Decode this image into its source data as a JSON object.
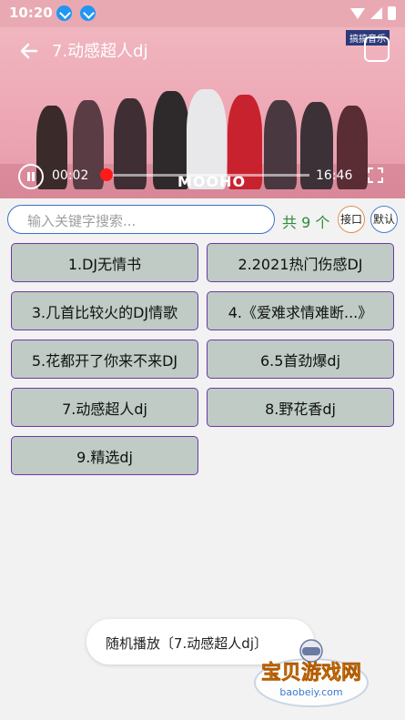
{
  "status_bar": {
    "time": "10:20"
  },
  "video": {
    "title": "7.动感超人dj",
    "badge": "搞搞音乐",
    "current_time": "00:02",
    "duration": "16:46",
    "progress": 0.002,
    "watermark": "MOOHO"
  },
  "search": {
    "placeholder": "输入关键字搜索...",
    "count_label": "共 9 个",
    "api_button": "接口",
    "default_button": "默认"
  },
  "songs": [
    "1.DJ无情书",
    "2.2021热门伤感DJ",
    "3.几首比较火的DJ情歌",
    "4.《爱难求情难断...》",
    "5.花都开了你来不来DJ",
    "6.5首劲爆dj",
    "7.动感超人dj",
    "8.野花香dj",
    "9.精选dj"
  ],
  "toast": {
    "text": "随机播放〔7.动感超人dj〕"
  },
  "watermark_site": {
    "name": "宝贝游戏网",
    "url": "baobeiy.com"
  },
  "colors": {
    "status_bg": "#e9a9b3",
    "item_bg": "#bfcbc4",
    "item_border": "#6a3aa8",
    "count_green": "#2e8b3a",
    "progress_red": "#ff1a1a"
  }
}
